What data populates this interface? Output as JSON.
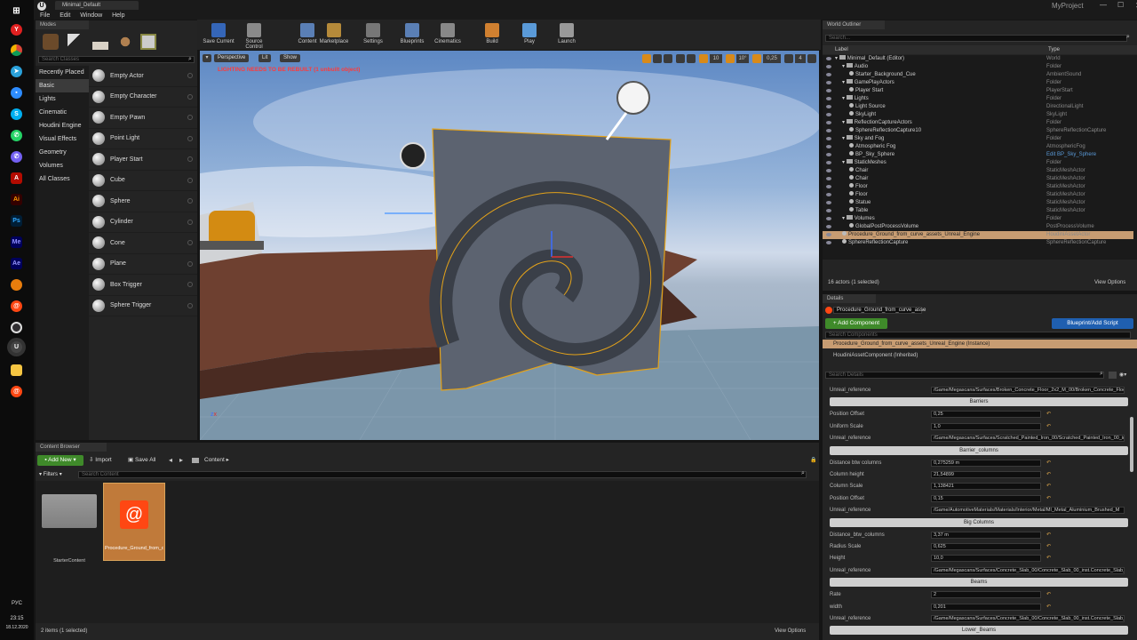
{
  "window": {
    "tab": "Minimal_Default",
    "project": "MyProject"
  },
  "menu": [
    "File",
    "Edit",
    "Window",
    "Help"
  ],
  "taskbar": {
    "time": "23:15",
    "date": "18.12.2020",
    "lang": "РУС"
  },
  "modes": {
    "tab": "Modes",
    "search_placeholder": "Search Classes",
    "categories": [
      "Recently Placed",
      "Basic",
      "Lights",
      "Cinematic",
      "Houdini Engine",
      "Visual Effects",
      "Geometry",
      "Volumes",
      "All Classes"
    ],
    "items": [
      "Empty Actor",
      "Empty Character",
      "Empty Pawn",
      "Point Light",
      "Player Start",
      "Cube",
      "Sphere",
      "Cylinder",
      "Cone",
      "Plane",
      "Box Trigger",
      "Sphere Trigger"
    ]
  },
  "toolbar": [
    "Save Current",
    "Source Control",
    "Content",
    "Marketplace",
    "Settings",
    "Blueprints",
    "Cinematics",
    "Build",
    "Play",
    "Launch"
  ],
  "viewport": {
    "perspective": "Perspective",
    "lit": "Lit",
    "show": "Show",
    "warning": "LIGHTING NEEDS TO BE REBUILT (1 unbuilt object)",
    "grid_snap": "10",
    "rot_snap": "10°",
    "scale_snap": "0,25",
    "cam_speed": "4"
  },
  "outliner": {
    "tab": "World Outliner",
    "search_placeholder": "Search...",
    "col_label": "Label",
    "col_type": "Type",
    "rows": [
      {
        "label": "Minimal_Default (Editor)",
        "type": "World",
        "indent": 0
      },
      {
        "label": "Audio",
        "type": "Folder",
        "indent": 1
      },
      {
        "label": "Starter_Background_Cue",
        "type": "AmbientSound",
        "indent": 2
      },
      {
        "label": "GamePlayActors",
        "type": "Folder",
        "indent": 1
      },
      {
        "label": "Player Start",
        "type": "PlayerStart",
        "indent": 2
      },
      {
        "label": "Lights",
        "type": "Folder",
        "indent": 1
      },
      {
        "label": "Light Source",
        "type": "DirectionalLight",
        "indent": 2
      },
      {
        "label": "SkyLight",
        "type": "SkyLight",
        "indent": 2
      },
      {
        "label": "ReflectionCaptureActors",
        "type": "Folder",
        "indent": 1
      },
      {
        "label": "SphereReflectionCapture10",
        "type": "SphereReflectionCapture",
        "indent": 2
      },
      {
        "label": "Sky and Fog",
        "type": "Folder",
        "indent": 1
      },
      {
        "label": "Atmospheric Fog",
        "type": "AtmosphericFog",
        "indent": 2
      },
      {
        "label": "BP_Sky_Sphere",
        "type": "Edit BP_Sky_Sphere",
        "indent": 2
      },
      {
        "label": "StaticMeshes",
        "type": "Folder",
        "indent": 1
      },
      {
        "label": "Chair",
        "type": "StaticMeshActor",
        "indent": 2
      },
      {
        "label": "Chair",
        "type": "StaticMeshActor",
        "indent": 2
      },
      {
        "label": "Floor",
        "type": "StaticMeshActor",
        "indent": 2
      },
      {
        "label": "Floor",
        "type": "StaticMeshActor",
        "indent": 2
      },
      {
        "label": "Statue",
        "type": "StaticMeshActor",
        "indent": 2
      },
      {
        "label": "Table",
        "type": "StaticMeshActor",
        "indent": 2
      },
      {
        "label": "Volumes",
        "type": "Folder",
        "indent": 1
      },
      {
        "label": "GlobalPostProcessVolume",
        "type": "PostProcessVolume",
        "indent": 2
      },
      {
        "label": "Procedure_Ground_from_curve_assets_Unreal_Engine",
        "type": "HoudiniAssetActor",
        "indent": 1
      },
      {
        "label": "SphereReflectionCapture",
        "type": "SphereReflectionCapture",
        "indent": 1
      }
    ],
    "status": "16 actors (1 selected)",
    "view_options": "View Options"
  },
  "details": {
    "tab": "Details",
    "name_value": "Procedure_Ground_from_curve_asse",
    "add_component": "+ Add Component",
    "blueprint": "Blueprint/Add Script",
    "search_components": "Search Components",
    "instance": "Procedure_Ground_from_curve_assets_Unreal_Engine (Instance)",
    "houdini_comp": "HoudiniAssetComponent (Inherited)",
    "search_details": "Search Details",
    "rows": [
      {
        "kind": "row",
        "label": "Unreal_reference",
        "value": "/Game/Megascans/Surfaces/Broken_Concrete_Floor_2x2_M_00/Broken_Concrete_Floor_"
      },
      {
        "kind": "section",
        "label": "Barriers"
      },
      {
        "kind": "row",
        "label": "Position Offset",
        "value": "0,25"
      },
      {
        "kind": "row",
        "label": "Uniform Scale",
        "value": "1,0"
      },
      {
        "kind": "row",
        "label": "Unreal_reference",
        "value": "/Game/Megascans/Surfaces/Scratched_Painted_Iron_00/Scratched_Painted_Iron_00_ins"
      },
      {
        "kind": "section",
        "label": "Barrier_columns"
      },
      {
        "kind": "row",
        "label": "Distance btw columns",
        "value": "0,275259 m"
      },
      {
        "kind": "row",
        "label": "Column height",
        "value": "21,54899"
      },
      {
        "kind": "row",
        "label": "Column Scale",
        "value": "1,138421"
      },
      {
        "kind": "row",
        "label": "Position Offset",
        "value": "0,15"
      },
      {
        "kind": "row",
        "label": "Unreal_reference",
        "value": "/Game/AutomotiveMaterials/Materials/Interior/Metal/MI_Metal_Aluminium_Brushed_M"
      },
      {
        "kind": "section",
        "label": "Big Columns"
      },
      {
        "kind": "row",
        "label": "Distance_btw_columns",
        "value": "3,37 m"
      },
      {
        "kind": "row",
        "label": "Radius Scale",
        "value": "0,625"
      },
      {
        "kind": "row",
        "label": "Height",
        "value": "10,0"
      },
      {
        "kind": "row",
        "label": "Unreal_reference",
        "value": "/Game/Megascans/Surfaces/Concrete_Slab_00/Concrete_Slab_00_inst.Concrete_Slab_00"
      },
      {
        "kind": "section",
        "label": "Beams"
      },
      {
        "kind": "row",
        "label": "Rate",
        "value": "2"
      },
      {
        "kind": "row",
        "label": "width",
        "value": "0,201"
      },
      {
        "kind": "row",
        "label": "Unreal_reference",
        "value": "/Game/Megascans/Surfaces/Concrete_Slab_00/Concrete_Slab_00_inst.Concrete_Slab_00"
      },
      {
        "kind": "section",
        "label": "Lower_Beams"
      }
    ]
  },
  "content_browser": {
    "tab": "Content Browser",
    "add_new": "Add New",
    "import": "Import",
    "save_all": "Save All",
    "path": "Content",
    "filters": "Filters",
    "search_placeholder": "Search Content",
    "assets": [
      {
        "name": "StarterContent",
        "kind": "folder"
      },
      {
        "name": "Procedure_Ground_from_curve_assets_Unreal_Engine",
        "kind": "houdini"
      }
    ],
    "status": "2 items (1 selected)",
    "view_options": "View Options"
  }
}
